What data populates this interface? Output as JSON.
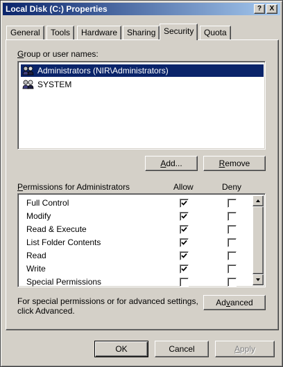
{
  "window": {
    "title": "Local Disk (C:) Properties",
    "help_btn": "?",
    "close_btn": "X"
  },
  "tabs": [
    {
      "label": "General"
    },
    {
      "label": "Tools"
    },
    {
      "label": "Hardware"
    },
    {
      "label": "Sharing"
    },
    {
      "label": "Security",
      "active": true
    },
    {
      "label": "Quota"
    }
  ],
  "security": {
    "group_label_first": "G",
    "group_label_rest": "roup or user names:",
    "users": [
      {
        "name": "Administrators (NIR\\Administrators)",
        "selected": true,
        "icon": "user-group-icon"
      },
      {
        "name": "SYSTEM",
        "selected": false,
        "icon": "user-group-icon"
      }
    ],
    "add_first": "A",
    "add_rest": "dd...",
    "remove_first": "R",
    "remove_rest": "emove",
    "perm_label_first": "P",
    "perm_label_rest": "ermissions for Administrators",
    "allow_header": "Allow",
    "deny_header": "Deny",
    "permissions": [
      {
        "name": "Full Control",
        "allow": true,
        "deny": false
      },
      {
        "name": "Modify",
        "allow": true,
        "deny": false
      },
      {
        "name": "Read & Execute",
        "allow": true,
        "deny": false
      },
      {
        "name": "List Folder Contents",
        "allow": true,
        "deny": false
      },
      {
        "name": "Read",
        "allow": true,
        "deny": false
      },
      {
        "name": "Write",
        "allow": true,
        "deny": false
      },
      {
        "name": "Special Permissions",
        "allow": false,
        "deny": false
      }
    ],
    "advanced_text_1": "For special permissions or for advanced settings,",
    "advanced_text_2": "click Advanced.",
    "advanced_pre": "Ad",
    "advanced_ul": "v",
    "advanced_post": "anced"
  },
  "footer": {
    "ok": "OK",
    "cancel": "Cancel",
    "apply_first": "A",
    "apply_rest": "pply"
  },
  "colors": {
    "title_start": "#0a246a",
    "title_end": "#a6caf0",
    "selection": "#0a246a",
    "face": "#d4d0c8"
  }
}
